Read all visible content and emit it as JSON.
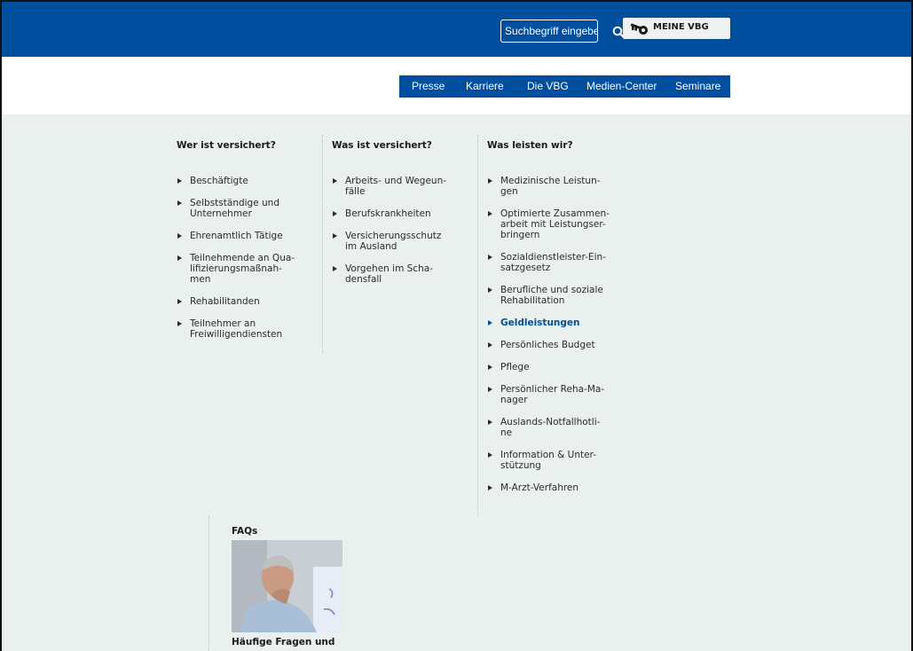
{
  "header": {
    "search_placeholder": "Suchbegriff eingeben",
    "meine_vbg_label": "MEINE VBG",
    "brand_color": "#004f9f"
  },
  "service_nav": {
    "items": [
      "Presse",
      "Karriere",
      "Die VBG",
      "Medien-Center",
      "Seminare"
    ]
  },
  "columns": [
    {
      "heading": "Wer ist versichert?",
      "items": [
        {
          "label": "Beschäftigte",
          "lines": [
            "Beschäftigte"
          ]
        },
        {
          "label": "Selbstständige und Unternehmer",
          "lines": [
            "Selbstständige und",
            "Unternehmer"
          ]
        },
        {
          "label": "Ehrenamtlich Tätige",
          "lines": [
            "Ehrenamtlich Tätige"
          ]
        },
        {
          "label": "Teilnehmende an Qualifizierungsmaßnahmen",
          "lines": [
            "Teilnehmende an Qua-",
            "lifizierungsmaßnah-",
            "men"
          ]
        },
        {
          "label": "Rehabilitanden",
          "lines": [
            "Rehabilitanden"
          ]
        },
        {
          "label": "Teilnehmer an Freiwilligendiensten",
          "lines": [
            "Teilnehmer an",
            "Freiwilligendiensten"
          ]
        }
      ]
    },
    {
      "heading": "Was ist versichert?",
      "items": [
        {
          "label": "Arbeits- und Wegeunfälle",
          "lines": [
            "Arbeits- und Wegeun-",
            "fälle"
          ]
        },
        {
          "label": "Berufskrankheiten",
          "lines": [
            "Berufskrankheiten"
          ]
        },
        {
          "label": "Versicherungsschutz im Ausland",
          "lines": [
            "Versicherungsschutz",
            "im Ausland"
          ]
        },
        {
          "label": "Vorgehen im Schadensfall",
          "lines": [
            "Vorgehen im Scha-",
            "densfall"
          ]
        }
      ]
    },
    {
      "heading": "Was leisten wir?",
      "items": [
        {
          "label": "Medizinische Leistungen",
          "lines": [
            "Medizinische Leistun-",
            "gen"
          ]
        },
        {
          "label": "Optimierte Zusammenarbeit mit Leistungserbringern",
          "lines": [
            "Optimierte Zusammen-",
            "arbeit mit Leistungser-",
            "bringern"
          ]
        },
        {
          "label": "Sozialdienstleister-Einsatzgesetz",
          "lines": [
            "Sozialdienstleister-Ein-",
            "satzgesetz"
          ]
        },
        {
          "label": "Berufliche und soziale Rehabilitation",
          "lines": [
            "Berufliche und soziale",
            "Rehabilitation"
          ]
        },
        {
          "label": "Geldleistungen",
          "lines": [
            "Geldleistungen"
          ],
          "active": true
        },
        {
          "label": "Persönliches Budget",
          "lines": [
            "Persönliches Budget"
          ]
        },
        {
          "label": "Pflege",
          "lines": [
            "Pflege"
          ]
        },
        {
          "label": "Persönlicher Reha-Manager",
          "lines": [
            "Persönlicher Reha-Ma-",
            "nager"
          ]
        },
        {
          "label": "Auslands-Notfallhotline",
          "lines": [
            "Auslands-Notfallhotli-",
            "ne"
          ]
        },
        {
          "label": "Information & Unterstützung",
          "lines": [
            "Information & Unter-",
            "stützung"
          ]
        },
        {
          "label": "M-Arzt-Verfahren",
          "lines": [
            "M-Arzt-Verfahren"
          ]
        }
      ]
    }
  ],
  "faq": {
    "heading": "FAQs",
    "caption": "Häufige Fragen und"
  }
}
